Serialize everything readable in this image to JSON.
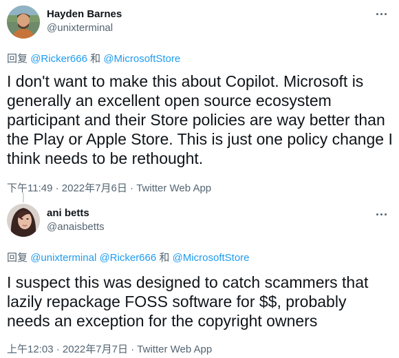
{
  "tweets": [
    {
      "name": "Hayden Barnes",
      "handle": "@unixterminal",
      "reply_prefix": "回复",
      "mentions": [
        "@Ricker666",
        "@MicrosoftStore"
      ],
      "connectors": [
        "和"
      ],
      "text": "I don't want to make this about Copilot. Microsoft is generally an excellent open source ecosystem participant and their Store policies are way better than the Play or Apple Store. This is just one policy change I think needs to be rethought.",
      "time": "下午11:49",
      "date": "2022年7月6日",
      "separator": "·",
      "source": "Twitter Web App"
    },
    {
      "name": "ani betts",
      "handle": "@anaisbetts",
      "reply_prefix": "回复",
      "mentions": [
        "@unixterminal",
        "@Ricker666",
        "@MicrosoftStore"
      ],
      "connectors": [
        "和"
      ],
      "text": "I suspect this was designed to catch scammers that lazily repackage FOSS software for $$, probably needs an exception for the copyright owners",
      "time": "上午12:03",
      "date": "2022年7月7日",
      "separator": "·",
      "source": "Twitter Web App"
    }
  ],
  "colors": {
    "text": "#0f1419",
    "secondary": "#536471",
    "link": "#1d9bf0",
    "thread_line": "#cfd9de"
  },
  "icons": [
    "more-options-icon",
    "avatar-photo"
  ]
}
